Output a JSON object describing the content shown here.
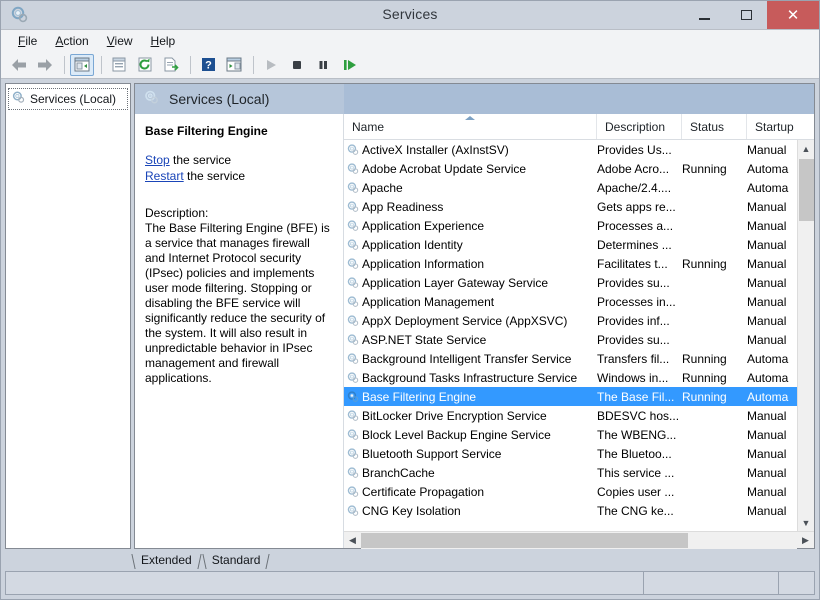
{
  "window": {
    "title": "Services",
    "icon": "services-gear-icon",
    "minimize_label": "Minimize",
    "maximize_label": "Maximize",
    "close_label": "Close"
  },
  "menu": [
    {
      "label": "File",
      "accel": "F"
    },
    {
      "label": "Action",
      "accel": "A"
    },
    {
      "label": "View",
      "accel": "V"
    },
    {
      "label": "Help",
      "accel": "H"
    }
  ],
  "toolbar": [
    {
      "name": "back-icon",
      "label": "Back"
    },
    {
      "name": "forward-icon",
      "label": "Forward"
    },
    {
      "name": "show-hide-console-tree-icon",
      "label": "Show/Hide Console Tree",
      "selected": true
    },
    {
      "name": "properties-icon",
      "label": "Properties"
    },
    {
      "name": "refresh-icon",
      "label": "Refresh"
    },
    {
      "name": "export-list-icon",
      "label": "Export List"
    },
    {
      "name": "help-icon",
      "label": "Help"
    },
    {
      "name": "show-action-pane-icon",
      "label": "Show/Hide Action Pane"
    },
    {
      "name": "start-service-icon",
      "label": "Start Service"
    },
    {
      "name": "stop-service-icon",
      "label": "Stop Service"
    },
    {
      "name": "pause-service-icon",
      "label": "Pause Service"
    },
    {
      "name": "restart-service-icon",
      "label": "Restart Service"
    }
  ],
  "tree": {
    "items": [
      {
        "label": "Services (Local)",
        "icon": "services-gear-icon",
        "selected": true
      }
    ]
  },
  "pane_header": {
    "title": "Services (Local)",
    "icon": "services-gear-icon"
  },
  "detail": {
    "title": "Base Filtering Engine",
    "links": [
      {
        "link": "Stop",
        "rest": " the service"
      },
      {
        "link": "Restart",
        "rest": " the service"
      }
    ],
    "description_label": "Description:",
    "description": "The Base Filtering Engine (BFE) is a service that manages firewall and Internet Protocol security (IPsec) policies and implements user mode filtering. Stopping or disabling the BFE service will significantly reduce the security of the system. It will also result in unpredictable behavior in IPsec management and firewall applications."
  },
  "list": {
    "columns": [
      {
        "label": "Name",
        "sorted": true
      },
      {
        "label": "Description",
        "sorted": false
      },
      {
        "label": "Status",
        "sorted": false
      },
      {
        "label": "Startup",
        "sorted": false
      }
    ],
    "rows": [
      {
        "name": "ActiveX Installer (AxInstSV)",
        "description": "Provides Us...",
        "status": "",
        "startup": "Manual",
        "selected": false
      },
      {
        "name": "Adobe Acrobat Update Service",
        "description": "Adobe Acro...",
        "status": "Running",
        "startup": "Automa",
        "selected": false
      },
      {
        "name": "Apache",
        "description": "Apache/2.4....",
        "status": "",
        "startup": "Automa",
        "selected": false
      },
      {
        "name": "App Readiness",
        "description": "Gets apps re...",
        "status": "",
        "startup": "Manual",
        "selected": false
      },
      {
        "name": "Application Experience",
        "description": "Processes a...",
        "status": "",
        "startup": "Manual",
        "selected": false
      },
      {
        "name": "Application Identity",
        "description": "Determines ...",
        "status": "",
        "startup": "Manual",
        "selected": false
      },
      {
        "name": "Application Information",
        "description": "Facilitates t...",
        "status": "Running",
        "startup": "Manual",
        "selected": false
      },
      {
        "name": "Application Layer Gateway Service",
        "description": "Provides su...",
        "status": "",
        "startup": "Manual",
        "selected": false
      },
      {
        "name": "Application Management",
        "description": "Processes in...",
        "status": "",
        "startup": "Manual",
        "selected": false
      },
      {
        "name": "AppX Deployment Service (AppXSVC)",
        "description": "Provides inf...",
        "status": "",
        "startup": "Manual",
        "selected": false
      },
      {
        "name": "ASP.NET State Service",
        "description": "Provides su...",
        "status": "",
        "startup": "Manual",
        "selected": false
      },
      {
        "name": "Background Intelligent Transfer Service",
        "description": "Transfers fil...",
        "status": "Running",
        "startup": "Automa",
        "selected": false
      },
      {
        "name": "Background Tasks Infrastructure Service",
        "description": "Windows in...",
        "status": "Running",
        "startup": "Automa",
        "selected": false
      },
      {
        "name": "Base Filtering Engine",
        "description": "The Base Fil...",
        "status": "Running",
        "startup": "Automa",
        "selected": true
      },
      {
        "name": "BitLocker Drive Encryption Service",
        "description": "BDESVC hos...",
        "status": "",
        "startup": "Manual",
        "selected": false
      },
      {
        "name": "Block Level Backup Engine Service",
        "description": "The WBENG...",
        "status": "",
        "startup": "Manual",
        "selected": false
      },
      {
        "name": "Bluetooth Support Service",
        "description": "The Bluetoo...",
        "status": "",
        "startup": "Manual",
        "selected": false
      },
      {
        "name": "BranchCache",
        "description": "This service ...",
        "status": "",
        "startup": "Manual",
        "selected": false
      },
      {
        "name": "Certificate Propagation",
        "description": "Copies user ...",
        "status": "",
        "startup": "Manual",
        "selected": false
      },
      {
        "name": "CNG Key Isolation",
        "description": "The CNG ke...",
        "status": "",
        "startup": "Manual",
        "selected": false
      }
    ]
  },
  "tabs": [
    {
      "label": "Extended",
      "active": false
    },
    {
      "label": "Standard",
      "active": true
    }
  ],
  "statusbar": {
    "main": "",
    "cell_a": "",
    "cell_b": ""
  },
  "colors": {
    "selection": "#3399ff",
    "pane_header": "#a9bdd6",
    "close_button": "#c75b5b",
    "link": "#1a45b8",
    "window_chrome": "#ccd3dd"
  }
}
